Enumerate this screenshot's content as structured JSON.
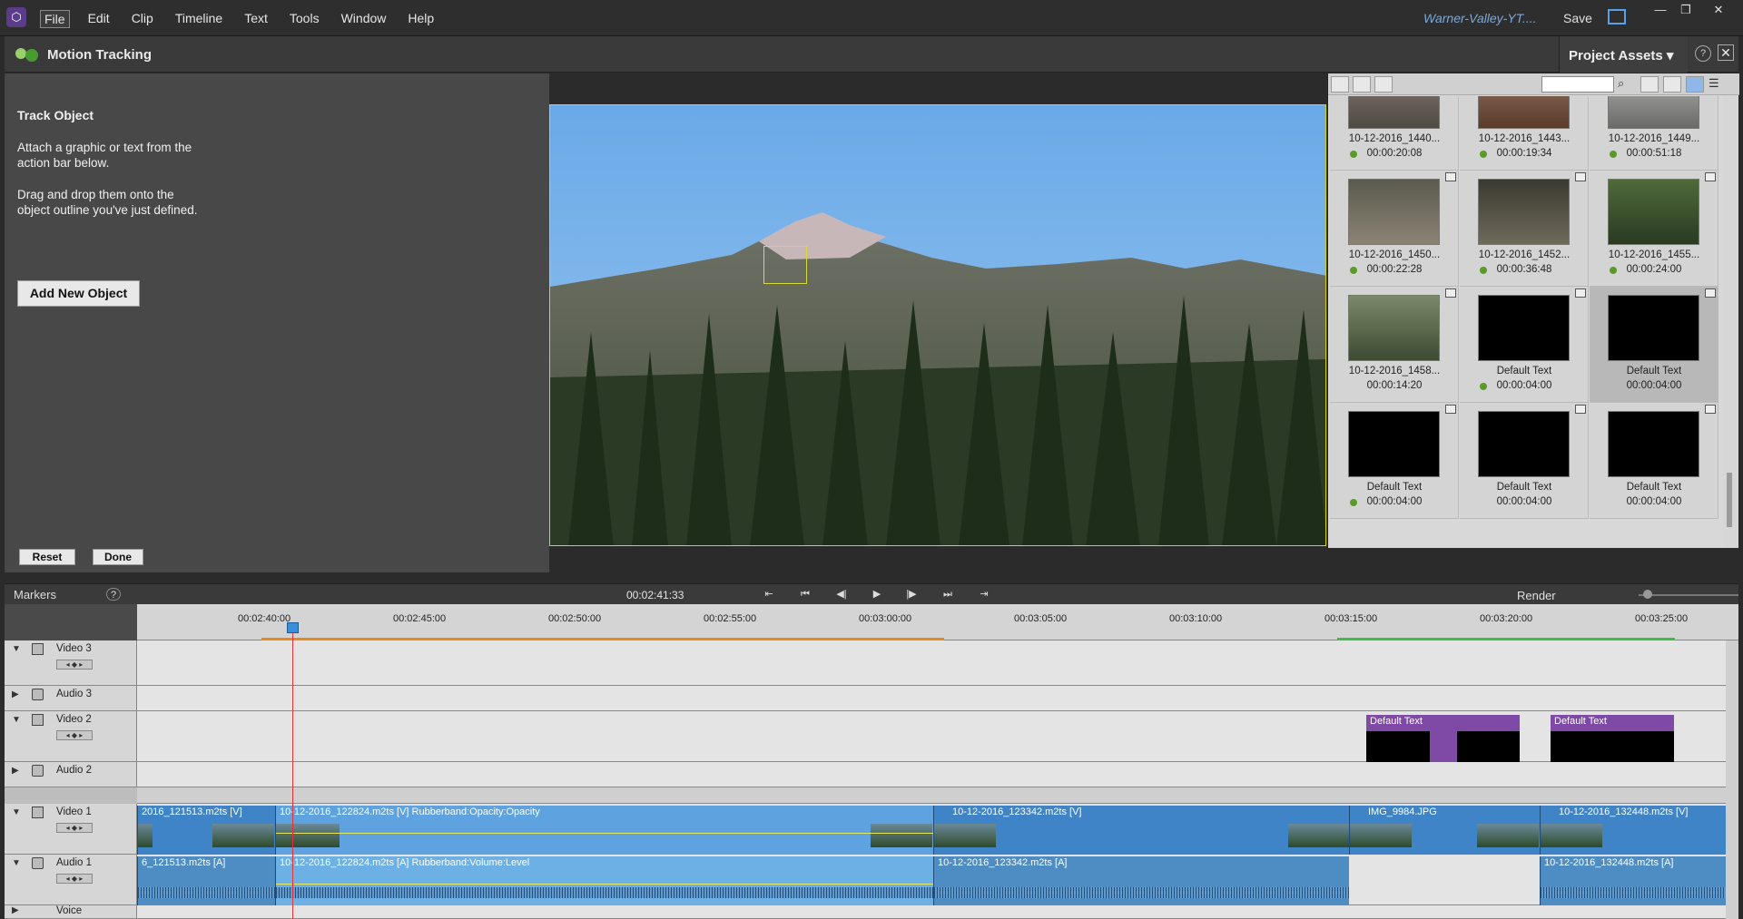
{
  "menubar": {
    "logo": "⬡",
    "menus": [
      "File",
      "Edit",
      "Clip",
      "Timeline",
      "Text",
      "Tools",
      "Window",
      "Help"
    ],
    "project_title": "Warner-Valley-YT....",
    "save_label": "Save",
    "window_controls": [
      "—",
      "❐",
      "✕"
    ]
  },
  "motion_tracking": {
    "title": "Motion Tracking",
    "panel_heading": "Track Object",
    "instruction_1": "Attach a graphic or text from the action bar below.",
    "instruction_2": "Drag and drop them onto the object outline you've just defined.",
    "add_button": "Add New Object",
    "reset_button": "Reset",
    "done_button": "Done"
  },
  "project_assets": {
    "title": "Project Assets ▾",
    "help": "?",
    "close": "✕",
    "items": [
      {
        "name": "10-12-2016_1440...",
        "duration": "00:00:20:08",
        "type": "video",
        "selected": false
      },
      {
        "name": "10-12-2016_1443...",
        "duration": "00:00:19:34",
        "type": "video",
        "selected": false
      },
      {
        "name": "10-12-2016_1449...",
        "duration": "00:00:51:18",
        "type": "video",
        "selected": false
      },
      {
        "name": "10-12-2016_1450...",
        "duration": "00:00:22:28",
        "type": "video",
        "selected": false
      },
      {
        "name": "10-12-2016_1452...",
        "duration": "00:00:36:48",
        "type": "video",
        "selected": false
      },
      {
        "name": "10-12-2016_1455...",
        "duration": "00:00:24:00",
        "type": "video",
        "selected": false
      },
      {
        "name": "10-12-2016_1458...",
        "duration": "00:00:14:20",
        "type": "video",
        "selected": false
      },
      {
        "name": "Default Text",
        "duration": "00:00:04:00",
        "type": "title",
        "selected": false
      },
      {
        "name": "Default Text",
        "duration": "00:00:04:00",
        "type": "title",
        "selected": true
      },
      {
        "name": "Default Text",
        "duration": "00:00:04:00",
        "type": "title",
        "selected": false
      },
      {
        "name": "Default Text",
        "duration": "00:00:04:00",
        "type": "title",
        "selected": false
      },
      {
        "name": "Default Text",
        "duration": "00:00:04:00",
        "type": "title",
        "selected": false
      }
    ]
  },
  "transport": {
    "markers_label": "Markers",
    "help": "?",
    "timecode": "00:02:41:33",
    "controls": [
      "⇤",
      "⏮",
      "◀|",
      "▶",
      "|▶",
      "⏭",
      "⇥"
    ],
    "render_label": "Render"
  },
  "timeline": {
    "ruler_labels": [
      "00:02:40:00",
      "00:02:45:00",
      "00:02:50:00",
      "00:02:55:00",
      "00:03:00:00",
      "00:03:05:00",
      "00:03:10:00",
      "00:03:15:00",
      "00:03:20:00",
      "00:03:25:00"
    ],
    "tracks": [
      {
        "name": "Video 3",
        "kind": "video"
      },
      {
        "name": "Audio 3",
        "kind": "audio"
      },
      {
        "name": "Video 2",
        "kind": "video"
      },
      {
        "name": "Audio 2",
        "kind": "audio"
      },
      {
        "name": "Video 1",
        "kind": "video"
      },
      {
        "name": "Audio 1",
        "kind": "audio"
      },
      {
        "name": "Voice",
        "kind": "audio"
      }
    ],
    "clips": {
      "v2_a": "Default Text",
      "v2_b": "Default Text",
      "v1_a": "2016_121513.m2ts [V]",
      "v1_b": "10-12-2016_122824.m2ts [V] Rubberband:Opacity:Opacity",
      "v1_c": "10-12-2016_123342.m2ts [V]",
      "v1_d": "IMG_9984.JPG",
      "v1_e": "10-12-2016_132448.m2ts [V]",
      "a1_a": "6_121513.m2ts [A]",
      "a1_b": "10-12-2016_122824.m2ts [A] Rubberband:Volume:Level",
      "a1_c": "10-12-2016_123342.m2ts [A]",
      "a1_d": "10-12-2016_132448.m2ts [A]"
    }
  }
}
